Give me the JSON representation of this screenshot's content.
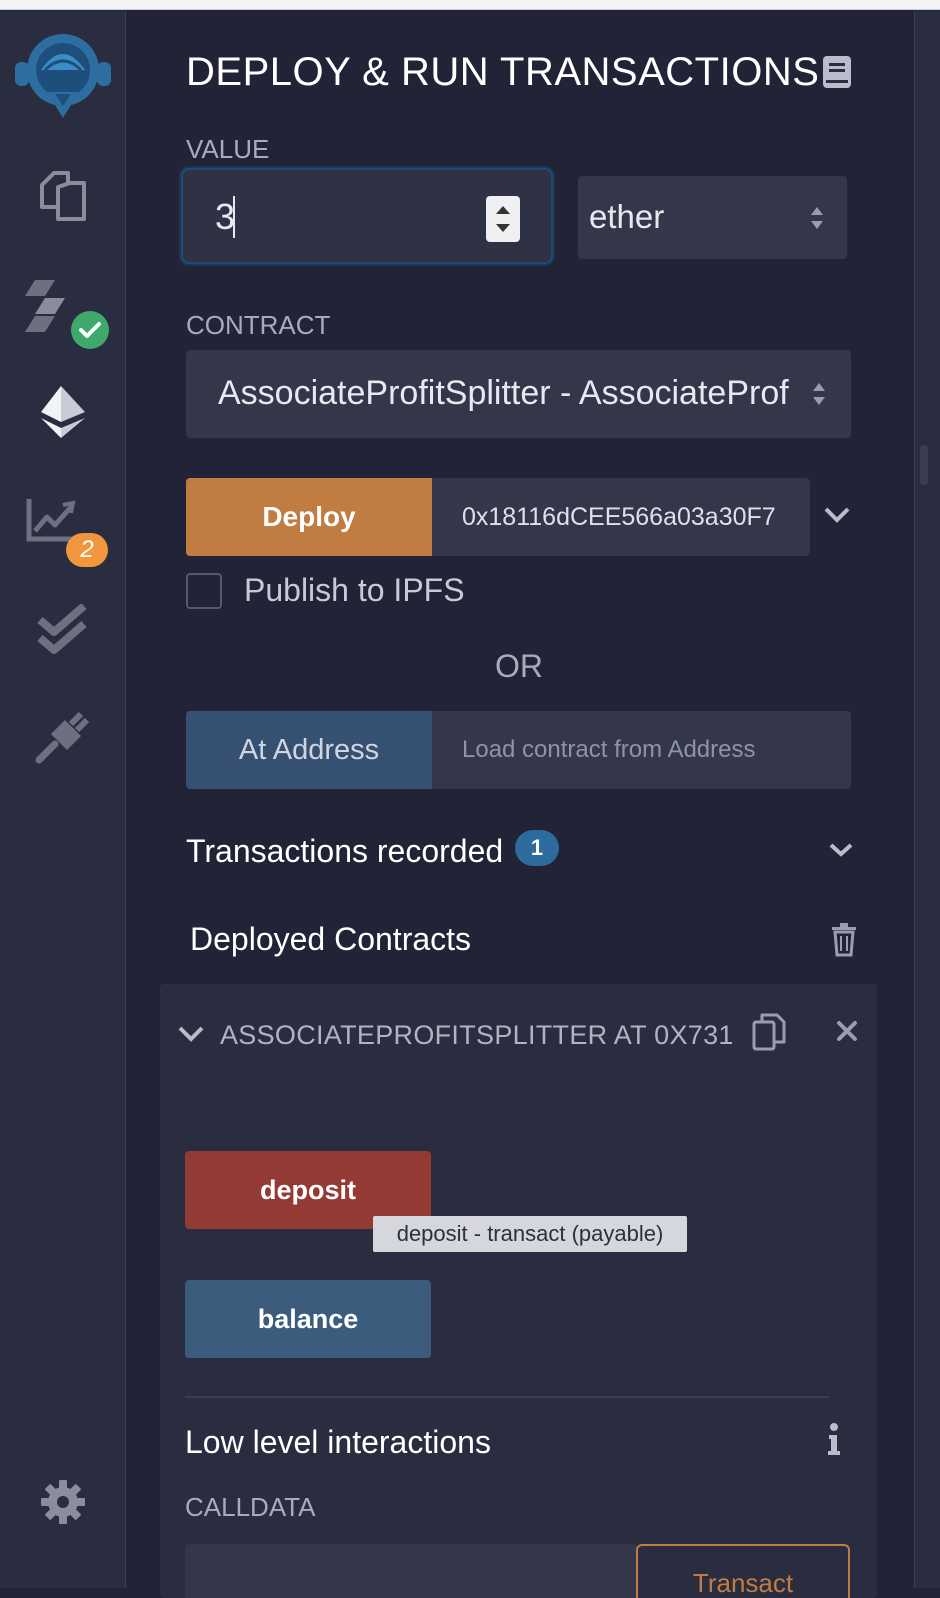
{
  "sidebar": {
    "items": [
      {
        "icon": "remix-logo-icon"
      },
      {
        "icon": "file-explorer-icon"
      },
      {
        "icon": "solidity-compiler-icon"
      },
      {
        "icon": "deploy-run-icon"
      },
      {
        "icon": "analysis-icon",
        "badge": "2"
      },
      {
        "icon": "testing-icon"
      },
      {
        "icon": "plugin-manager-icon"
      },
      {
        "icon": "settings-icon"
      }
    ]
  },
  "header": {
    "title": "DEPLOY & RUN TRANSACTIONS",
    "doc_icon": "book-icon"
  },
  "value": {
    "label": "VALUE",
    "amount": "3",
    "unit": "ether"
  },
  "contract": {
    "label": "CONTRACT",
    "selected": "AssociateProfitSplitter - AssociateProf"
  },
  "deploy": {
    "button_label": "Deploy",
    "constructor_arg": "0x18116dCEE566a03a30F7"
  },
  "publish": {
    "label": "Publish to IPFS",
    "checked": false
  },
  "or_label": "OR",
  "at_address": {
    "button_label": "At Address",
    "placeholder": "Load contract from Address"
  },
  "transactions": {
    "label": "Transactions recorded",
    "count": "1"
  },
  "deployed": {
    "label": "Deployed Contracts",
    "instance": {
      "title": "ASSOCIATEPROFITSPLITTER AT 0X731",
      "functions": [
        {
          "label": "deposit",
          "color": "#943a35"
        },
        {
          "label": "balance",
          "color": "#3b5c7c"
        }
      ],
      "tooltip": "deposit - transact (payable)",
      "low_level": {
        "label": "Low level interactions",
        "calldata_label": "CALLDATA",
        "transact_label": "Transact"
      }
    }
  },
  "colors": {
    "accent_orange": "#c17c42",
    "deploy_blue": "#355071",
    "badge_orange": "#f0963c",
    "badge_blue": "#2b6b9e",
    "check_green": "#3fa96c"
  }
}
